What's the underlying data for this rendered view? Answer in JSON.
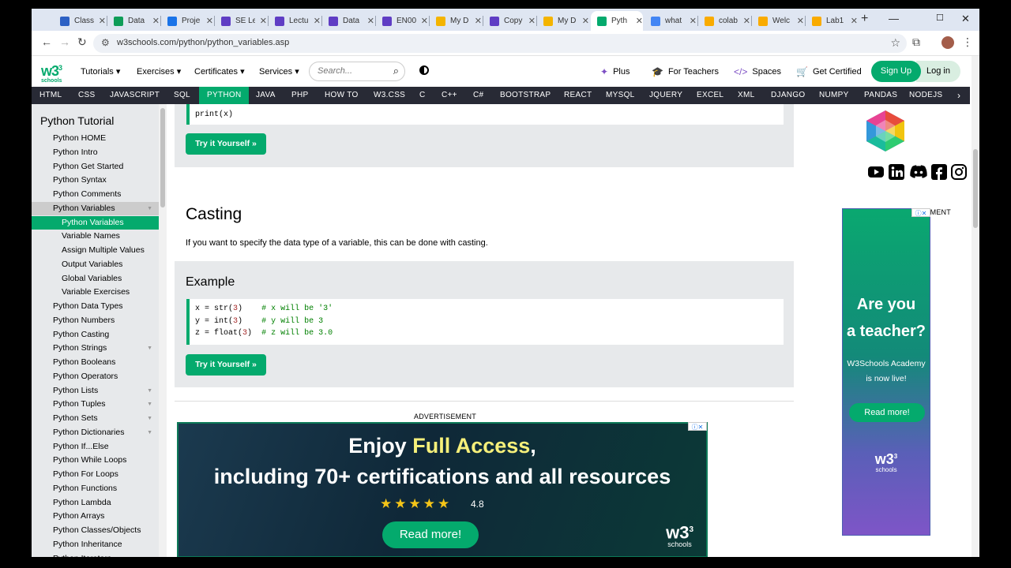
{
  "browser": {
    "tabs": [
      {
        "label": "Class",
        "color": "#2d61c4"
      },
      {
        "label": "Data",
        "color": "#0f9d58"
      },
      {
        "label": "Proje",
        "color": "#1a73e8"
      },
      {
        "label": "SE Le",
        "color": "#5f3dc4"
      },
      {
        "label": "Lectu",
        "color": "#5f3dc4"
      },
      {
        "label": "Data",
        "color": "#5f3dc4"
      },
      {
        "label": "EN00",
        "color": "#5f3dc4"
      },
      {
        "label": "My D",
        "color": "#f4b400"
      },
      {
        "label": "Copy",
        "color": "#5f3dc4"
      },
      {
        "label": "My D",
        "color": "#f4b400"
      },
      {
        "label": "Pyth",
        "color": "#04aa6d"
      },
      {
        "label": "what",
        "color": "#4285f4"
      },
      {
        "label": "colab",
        "color": "#f9ab00"
      },
      {
        "label": "Welc",
        "color": "#f9ab00"
      },
      {
        "label": "Lab1",
        "color": "#f9ab00"
      }
    ],
    "url": "w3schools.com/python/python_variables.asp"
  },
  "header": {
    "menu": [
      "Tutorials ▾",
      "Exercises ▾",
      "Certificates ▾",
      "Services ▾"
    ],
    "search_placeholder": "Search...",
    "plus": "Plus",
    "for_teachers": "For Teachers",
    "spaces": "Spaces",
    "get_certified": "Get Certified",
    "sign_up": "Sign Up",
    "log_in": "Log in"
  },
  "langnav": [
    "HTML",
    "CSS",
    "JAVASCRIPT",
    "SQL",
    "PYTHON",
    "JAVA",
    "PHP",
    "HOW TO",
    "W3.CSS",
    "C",
    "C++",
    "C#",
    "BOOTSTRAP",
    "REACT",
    "MYSQL",
    "JQUERY",
    "EXCEL",
    "XML",
    "DJANGO",
    "NUMPY",
    "PANDAS",
    "NODEJS"
  ],
  "sidebar": {
    "title": "Python Tutorial",
    "items": [
      {
        "label": "Python HOME"
      },
      {
        "label": "Python Intro"
      },
      {
        "label": "Python Get Started"
      },
      {
        "label": "Python Syntax"
      },
      {
        "label": "Python Comments"
      },
      {
        "label": "Python Variables",
        "state": "selected"
      },
      {
        "label": "Python Variables",
        "state": "current"
      },
      {
        "label": "Variable Names",
        "state": "sub"
      },
      {
        "label": "Assign Multiple Values",
        "state": "sub"
      },
      {
        "label": "Output Variables",
        "state": "sub"
      },
      {
        "label": "Global Variables",
        "state": "sub"
      },
      {
        "label": "Variable Exercises",
        "state": "sub"
      },
      {
        "label": "Python Data Types"
      },
      {
        "label": "Python Numbers"
      },
      {
        "label": "Python Casting"
      },
      {
        "label": "Python Strings",
        "caret": true
      },
      {
        "label": "Python Booleans"
      },
      {
        "label": "Python Operators"
      },
      {
        "label": "Python Lists",
        "caret": true
      },
      {
        "label": "Python Tuples",
        "caret": true
      },
      {
        "label": "Python Sets",
        "caret": true
      },
      {
        "label": "Python Dictionaries",
        "caret": true
      },
      {
        "label": "Python If...Else"
      },
      {
        "label": "Python While Loops"
      },
      {
        "label": "Python For Loops"
      },
      {
        "label": "Python Functions"
      },
      {
        "label": "Python Lambda"
      },
      {
        "label": "Python Arrays"
      },
      {
        "label": "Python Classes/Objects"
      },
      {
        "label": "Python Inheritance"
      },
      {
        "label": "Python Iterators"
      }
    ]
  },
  "main": {
    "prev_code_line": "print(x)",
    "try_it": "Try it Yourself »",
    "heading": "Casting",
    "intro": "If you want to specify the data type of a variable, this can be done with casting.",
    "example_heading": "Example",
    "code": [
      {
        "var": "x = ",
        "fn": "str(",
        "num": "3",
        "close": ")    ",
        "comment": "# x will be '3'"
      },
      {
        "var": "y = ",
        "fn": "int(",
        "num": "3",
        "close": ")    ",
        "comment": "# y will be 3"
      },
      {
        "var": "z = ",
        "fn": "float(",
        "num": "3",
        "close": ")  ",
        "comment": "# z will be 3.0"
      }
    ],
    "advertisement": "ADVERTISEMENT",
    "ad": {
      "line1_a": "Enjoy ",
      "line1_b": "Full Access",
      "line1_c": ",",
      "line2": "including 70+ certifications and all resources",
      "stars": "★★★★★",
      "rating": "4.8",
      "read_more": "Read more!",
      "brand_mark": "w3",
      "brand_sup": "3",
      "brand": "schools"
    }
  },
  "right": {
    "advertisement": "ADVERTISEMENT",
    "ad": {
      "line1": "Are you",
      "line2": "a teacher?",
      "sub1": "W3Schools Academy",
      "sub2": "is now live!",
      "read_more": "Read more!",
      "brand_mark": "w3",
      "brand_sup": "3",
      "brand": "schools"
    }
  },
  "logo": {
    "mark": "w3",
    "sup": "3",
    "text": "schools"
  }
}
